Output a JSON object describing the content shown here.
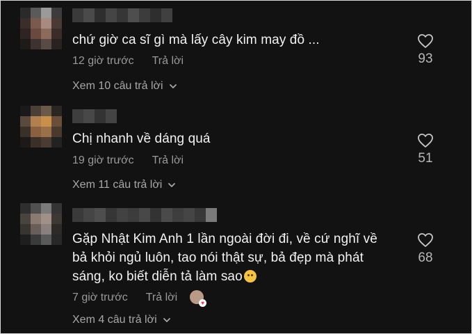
{
  "comments": [
    {
      "text": "chứ giờ ca sĩ gì mà lấy cây kim may đồ ...",
      "time": "12 giờ trước",
      "reply_label": "Trả lời",
      "view_replies": "Xem 10 câu trả lời",
      "likes": "93"
    },
    {
      "text": "Chị nhanh về dáng quá",
      "time": "19 giờ trước",
      "reply_label": "Trả lời",
      "view_replies": "Xem 11 câu trả lời",
      "likes": "51"
    },
    {
      "text": "Gặp Nhật Kim Anh 1 lần ngoài đời đi, về cứ nghĩ về\nbả khỏi ngủ luôn, tao nói thật sự, bả đẹp mà phát\nsáng, ko biết diễn tả làm sao",
      "time": "7 giờ trước",
      "reply_label": "Trả lời",
      "view_replies": "Xem 4 câu trả lời",
      "likes": "68"
    }
  ],
  "icons": {
    "like": "heart-outline-icon",
    "expand": "chevron-down-icon",
    "emoji": "grinning-face-emoji",
    "creator_liked": "creator-liked-heart-icon"
  },
  "colors": {
    "background": "#121212",
    "text_primary": "#f2f2f2",
    "text_secondary": "#9a9a9a",
    "heart_badge": "#fe2c55"
  }
}
